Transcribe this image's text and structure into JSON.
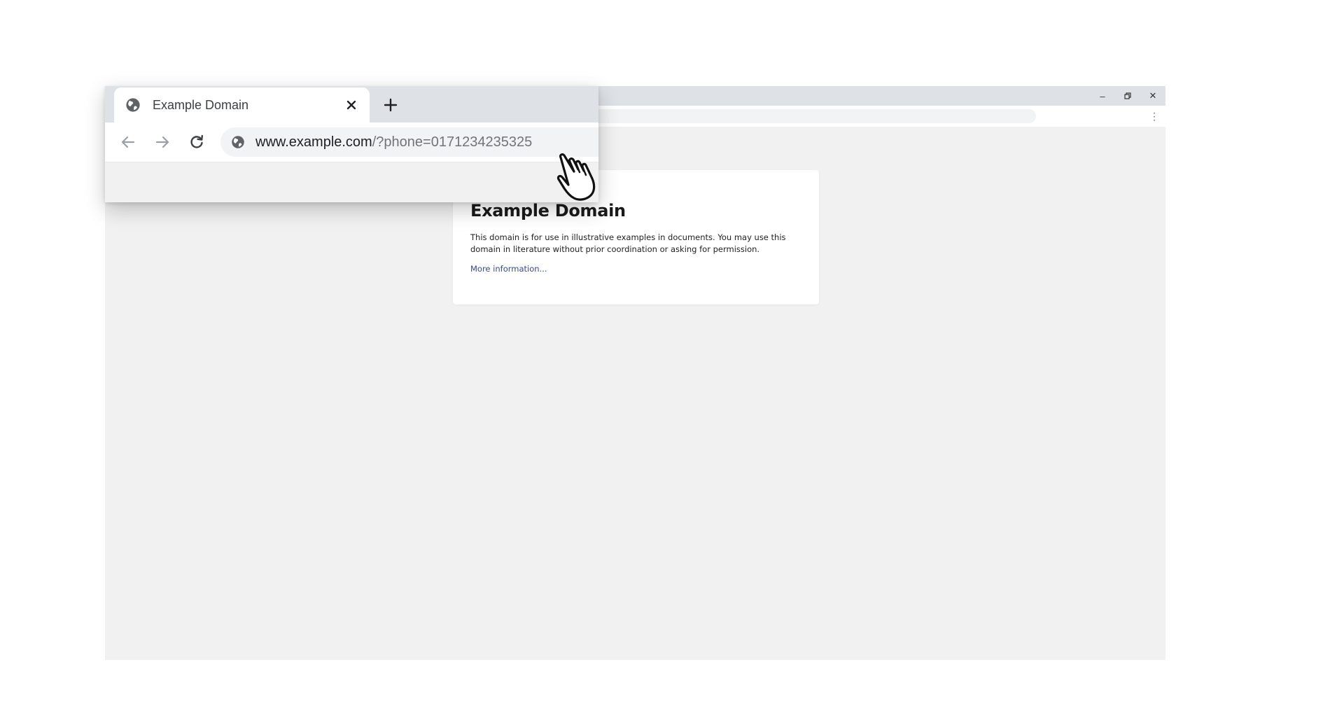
{
  "tab": {
    "title": "Example Domain"
  },
  "address_bar": {
    "url_host": "www.example.com",
    "url_query": "/?phone=0171234235325"
  },
  "page": {
    "heading": "Example Domain",
    "description": "This domain is for use in illustrative examples in documents. You may use this domain in literature without prior coordination or asking for permission.",
    "link_text": "More information..."
  },
  "window_controls": {
    "minimize": "–",
    "maximize": "▫",
    "close": "✕",
    "menu": "⋮"
  },
  "icons": {
    "tab_icon": "globe-icon",
    "tab_close": "close-icon",
    "new_tab": "plus-icon",
    "back": "arrow-left-icon",
    "forward": "arrow-right-icon",
    "reload": "reload-icon",
    "site_info": "globe-icon",
    "cursor": "hand-pointer-icon"
  },
  "colors": {
    "tab_strip": "#dee1e6",
    "page_background": "#f1f1f1",
    "link": "#38488f"
  }
}
